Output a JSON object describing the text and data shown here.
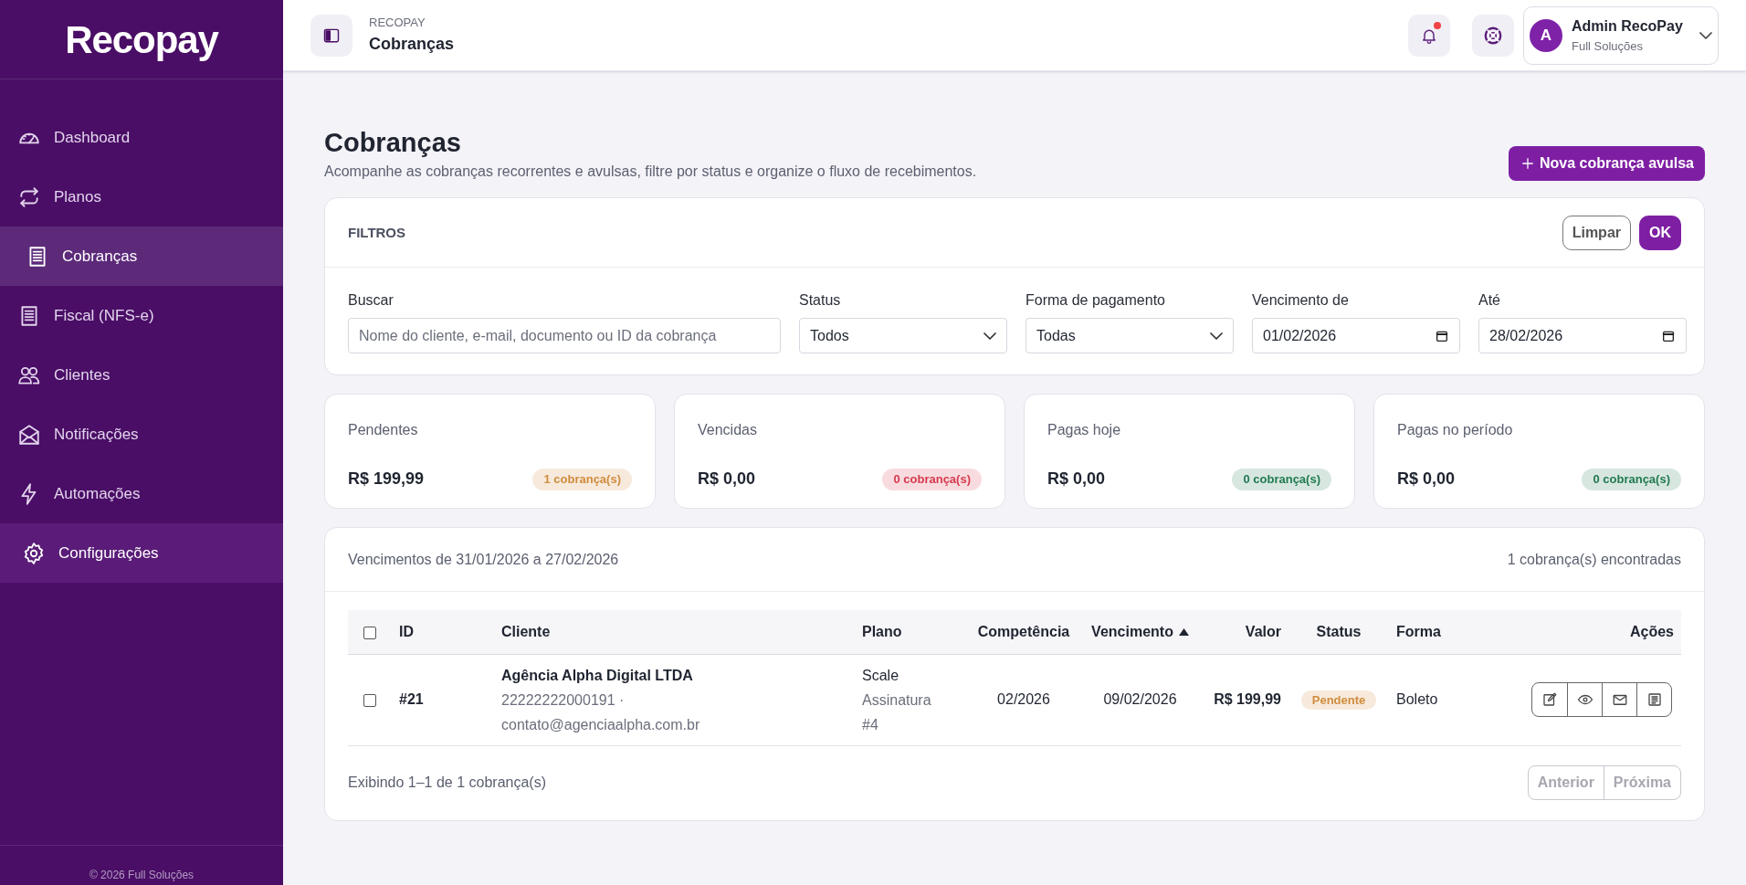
{
  "sidebar": {
    "logo": "Recopay",
    "items": [
      {
        "label": "Dashboard",
        "selected": false,
        "hovered": false
      },
      {
        "label": "Planos",
        "selected": false,
        "hovered": false
      },
      {
        "label": "Cobranças",
        "selected": true,
        "hovered": false
      },
      {
        "label": "Fiscal (NFS-e)",
        "selected": false,
        "hovered": false
      },
      {
        "label": "Clientes",
        "selected": false,
        "hovered": false
      },
      {
        "label": "Notificações",
        "selected": false,
        "hovered": false
      },
      {
        "label": "Automações",
        "selected": false,
        "hovered": false
      },
      {
        "label": "Configurações",
        "selected": false,
        "hovered": true
      }
    ],
    "footer": "© 2026 Full Soluções"
  },
  "header": {
    "breadcrumb": "RECOPAY",
    "title": "Cobranças",
    "notification_unread": true,
    "user": {
      "initial": "A",
      "name": "Admin RecoPay",
      "org": "Full Soluções"
    }
  },
  "page": {
    "title": "Cobranças",
    "subtitle": "Acompanhe as cobranças recorrentes e avulsas, filtre por status e organize o fluxo de recebimentos.",
    "new_button": "Nova cobrança avulsa"
  },
  "filters": {
    "title": "FILTROS",
    "clear_button": "Limpar",
    "ok_button": "OK",
    "fields": [
      {
        "kind": "text",
        "label": "Buscar",
        "placeholder": "Nome do cliente, e-mail, documento ou ID da cobrança"
      },
      {
        "kind": "select",
        "label": "Status",
        "value": "Todos"
      },
      {
        "kind": "select",
        "label": "Forma de pagamento",
        "value": "Todas"
      },
      {
        "kind": "date",
        "label": "Vencimento de",
        "value": "01/02/2026"
      },
      {
        "kind": "date",
        "label": "Até",
        "value": "28/02/2026"
      }
    ]
  },
  "stats": [
    {
      "label": "Pendentes",
      "value": "R$ 199,99",
      "badge": "1 cobrança(s)",
      "color": "#d08c3d"
    },
    {
      "label": "Vencidas",
      "value": "R$ 0,00",
      "badge": "0 cobrança(s)",
      "color": "#d63a4f"
    },
    {
      "label": "Pagas hoje",
      "value": "R$ 0,00",
      "badge": "0 cobrança(s)",
      "color": "#217a52"
    },
    {
      "label": "Pagas no período",
      "value": "R$ 0,00",
      "badge": "0 cobrança(s)",
      "color": "#217a52"
    }
  ],
  "table": {
    "range": "Vencimentos de 31/01/2026 a 27/02/2026",
    "count": "1 cobrança(s) encontradas",
    "select_all_checked": false,
    "columns": [
      {
        "label": "ID",
        "sorted": false
      },
      {
        "label": "Cliente",
        "sorted": false
      },
      {
        "label": "Plano",
        "sorted": false
      },
      {
        "label": "Competência",
        "sorted": false
      },
      {
        "label": "Vencimento",
        "sorted": true
      },
      {
        "label": "Valor",
        "sorted": false
      },
      {
        "label": "Status",
        "sorted": false
      },
      {
        "label": "Forma",
        "sorted": false
      },
      {
        "label": "Ações",
        "sorted": false
      }
    ],
    "rows": [
      {
        "checked": false,
        "id": "#21",
        "client": "Agência Alpha Digital LTDA",
        "client_doc": "22222222000191 ·",
        "client_email": "contato@agenciaalpha.com.br",
        "plan": "Scale",
        "plan_detail": "Assinatura #4",
        "competence": "02/2026",
        "due": "09/02/2026",
        "amount": "R$ 199,99",
        "status": "Pendente",
        "color": "#d08c3d",
        "method": "Boleto"
      }
    ],
    "footer": "Exibindo 1–1 de 1 cobrança(s)",
    "prev_button": {
      "label": "Anterior",
      "disabled": true
    },
    "next_button": {
      "label": "Próxima",
      "disabled": true
    }
  }
}
